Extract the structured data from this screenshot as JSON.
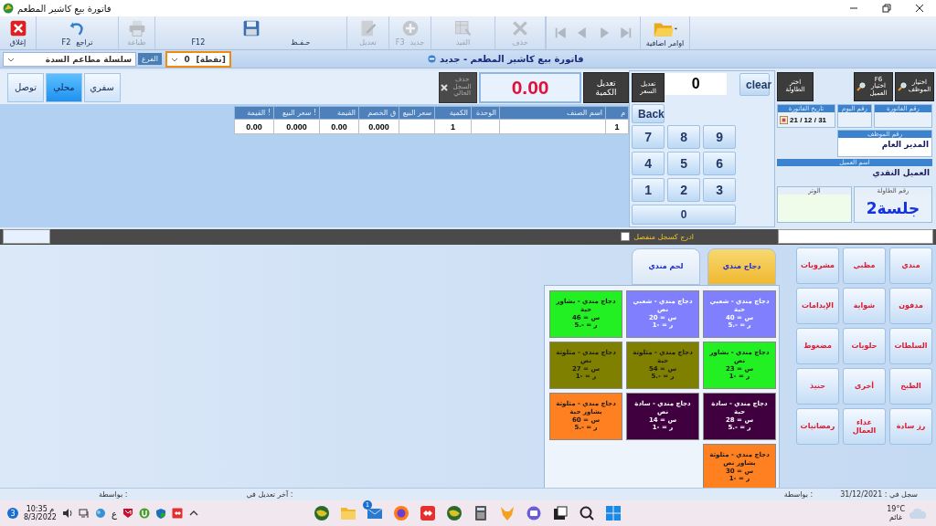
{
  "window": {
    "title": "فاتورة بيع كاشير المطعم"
  },
  "toolbar": [
    {
      "kind": "folder",
      "label": "اوامر اضافية",
      "disabled": false
    },
    {
      "kind": "last",
      "disabled": true
    },
    {
      "kind": "next",
      "disabled": true
    },
    {
      "kind": "prev",
      "disabled": true
    },
    {
      "kind": "first",
      "disabled": true
    },
    {
      "kind": "delete",
      "label": "حذف",
      "disabled": true
    },
    {
      "kind": "ledger",
      "label": "القيد",
      "disabled": true
    },
    {
      "kind": "new",
      "label": "جديد",
      "shortcut": "F3",
      "disabled": true
    },
    {
      "kind": "edit",
      "label": "تعديل",
      "disabled": true
    },
    {
      "kind": "save",
      "label": "حـفـظ",
      "shortcut": "F12",
      "disabled": false
    },
    {
      "kind": "print",
      "label": "طباعة",
      "disabled": true
    },
    {
      "kind": "undo",
      "label": "تراجع",
      "shortcut": "F2",
      "disabled": false
    },
    {
      "kind": "close",
      "label": "إغلاق",
      "disabled": false
    }
  ],
  "filters": {
    "branch_value": "سلسلة مطاعم السدة",
    "branch_label": "الفرع",
    "point_label": "[نقطة]",
    "point_value": "0"
  },
  "form_title": "فاتورة بيع كاشير المطعم - جديد",
  "order_types": [
    {
      "label": "سفري",
      "selected": false
    },
    {
      "label": "محلي",
      "selected": true
    },
    {
      "label": "توصل",
      "selected": false
    }
  ],
  "quantity_button": "تعديل الكمية",
  "amount": "0.00",
  "delete_record": {
    "label": "حذف السجل الحالي",
    "disabled": true
  },
  "table": {
    "columns": [
      "م",
      "اسم الصنف",
      "الوحدة",
      "الكمية",
      "سعر البيع",
      "ق الخصم",
      "القيمة",
      "! سعر البيع",
      "! القيمة"
    ],
    "rows": [
      {
        "cells": [
          "1",
          null,
          null,
          "1",
          null,
          "0.000",
          "0.00",
          "0.000",
          "0.00"
        ]
      }
    ]
  },
  "keypad": {
    "price_button": "تعديل السعر",
    "display": "0",
    "clear": "clear",
    "back": "Back",
    "keys": [
      "9",
      "8",
      "7",
      "6",
      "5",
      "4",
      "3",
      "2",
      "1",
      "0"
    ]
  },
  "side_buttons": [
    {
      "label": "اختيار الموظف",
      "kind": "search"
    },
    {
      "label": "اختيار العميل",
      "shortcut": "F6",
      "kind": "search"
    },
    {
      "label": "اختر الطاولة",
      "kind": "plain"
    }
  ],
  "invoice": {
    "invoice_no_label": "رقم الفاتورة",
    "day_no_label": "رقم اليوم",
    "date_label": "تاريخ الفاتورة",
    "date": "31 / 12 / 21",
    "employee_label": "رقم الموظف",
    "employee": "المدير العام",
    "customer_label": "اسم العميل",
    "customer": "العميل النقدي",
    "table_label": "رقم الطاولة",
    "table_value": "جلسة2",
    "note_label": "الوتر"
  },
  "separate_record": {
    "label": "ادرج كسجل منفصل",
    "checked": false
  },
  "product_tabs": [
    {
      "label": "دجاج مندي",
      "selected": true
    },
    {
      "label": "لحم مندي",
      "selected": false
    }
  ],
  "products": [
    {
      "name": "دجاج مندي - شعبي",
      "portion": "حبة",
      "price": "س = 40",
      "discount": "ر = -.5",
      "color": "#8080ff"
    },
    {
      "name": "دجاج مندي - شعبي",
      "portion": "نص",
      "price": "س = 20",
      "discount": "ر = -1",
      "color": "#8080ff"
    },
    {
      "name": "دجاج مندي - بشاور",
      "portion": "حبة",
      "price": "س = 46",
      "discount": "ر = -.5",
      "color": "#22f022"
    },
    {
      "name": "دجاج مندي - بشاور",
      "portion": "نص",
      "price": "س = 23",
      "discount": "ر = -1",
      "color": "#22f022"
    },
    {
      "name": "دجاج مندي - مثلوثة",
      "portion": "حبة",
      "price": "س = 54",
      "discount": "ر = -.5",
      "color": "#808000"
    },
    {
      "name": "دجاج مندي - مثلوثة",
      "portion": "نص",
      "price": "س = 27",
      "discount": "ر = -1",
      "color": "#808000"
    },
    {
      "name": "دجاج مندي - سادة",
      "portion": "حبة",
      "price": "س = 28",
      "discount": "ر = -.5",
      "color": "#400040"
    },
    {
      "name": "دجاج مندي - سادة",
      "portion": "نص",
      "price": "س = 14",
      "discount": "ر = -1",
      "color": "#400040"
    },
    {
      "name": "دجاج مندي - مثلوثة",
      "portion": "بشاور حبة",
      "price": "س = 60",
      "discount": "ر = -.5",
      "color": "#ff8020"
    },
    {
      "name": "دجاج مندي - مثلوثة",
      "portion": "بشاور نص",
      "price": "س = 30",
      "discount": "ر = -1",
      "color": "#ff8020"
    }
  ],
  "categories": [
    "مندي",
    "مظبي",
    "مشروبات",
    "مدفون",
    "شواية",
    "الإيدامات",
    "السلطات",
    "حلويات",
    "مضغوط",
    "الطبخ",
    "أخرى",
    "حنيذ",
    "رز سادة",
    "غداء العمال",
    "رمضانيات"
  ],
  "status_bar": {
    "created_label": "سجل في :",
    "created": "31/12/2021",
    "created_by": "بواسطة :",
    "modified_label": "آخر تعديل في :",
    "modified_by": "بواسطة :"
  },
  "taskbar": {
    "notifications": "3",
    "time": "10:35 م",
    "date": "8/3/2022",
    "language": "ع",
    "tray": [
      {
        "kind": "speaker"
      },
      {
        "kind": "network"
      },
      {
        "kind": "globe"
      },
      {
        "kind": "antivirus"
      },
      {
        "kind": "torrent"
      },
      {
        "kind": "shield"
      },
      {
        "kind": "remote"
      }
    ],
    "apps": [
      {
        "kind": "globe"
      },
      {
        "kind": "folder"
      },
      {
        "kind": "mail",
        "badge": "1"
      },
      {
        "kind": "browser"
      },
      {
        "kind": "remote"
      },
      {
        "kind": "globe"
      },
      {
        "kind": "calculator"
      },
      {
        "kind": "fox"
      },
      {
        "kind": "chat"
      },
      {
        "kind": "window"
      },
      {
        "kind": "search"
      },
      {
        "kind": "start"
      }
    ],
    "temperature": "19°C",
    "weather": "غائم"
  }
}
